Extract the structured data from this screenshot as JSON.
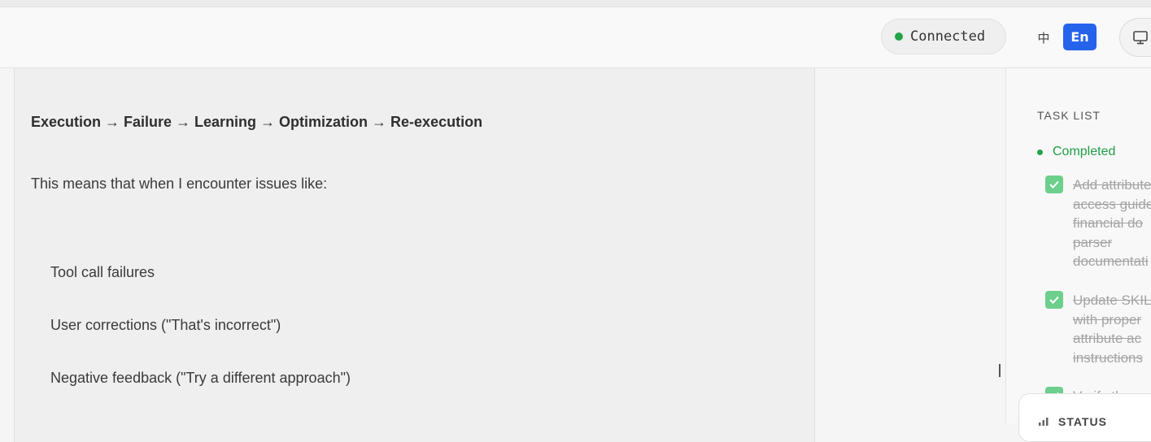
{
  "header": {
    "connection_status": "Connected",
    "lang_zh": "中",
    "lang_en": "En"
  },
  "chat": {
    "cycle": "Execution → Failure → Learning → Optimization → Re-execution",
    "intro": "This means that when I encounter issues like:",
    "items": [
      "Tool call failures",
      "User corrections (\"That's incorrect\")",
      "Negative feedback (\"Try a different approach\")"
    ]
  },
  "sidebar": {
    "title": "TASK LIST",
    "group_label": "Completed",
    "tasks": [
      "Add attribute\naccess guide\nfinancial do\nparser\ndocumentati",
      "Update SKILL\nwith proper\nattribute ac\ninstructions",
      "Verify the"
    ],
    "status_label": "STATUS"
  },
  "colors": {
    "accent": "#2563eb",
    "connected": "#22a447",
    "task_check": "#6ccf8c"
  }
}
